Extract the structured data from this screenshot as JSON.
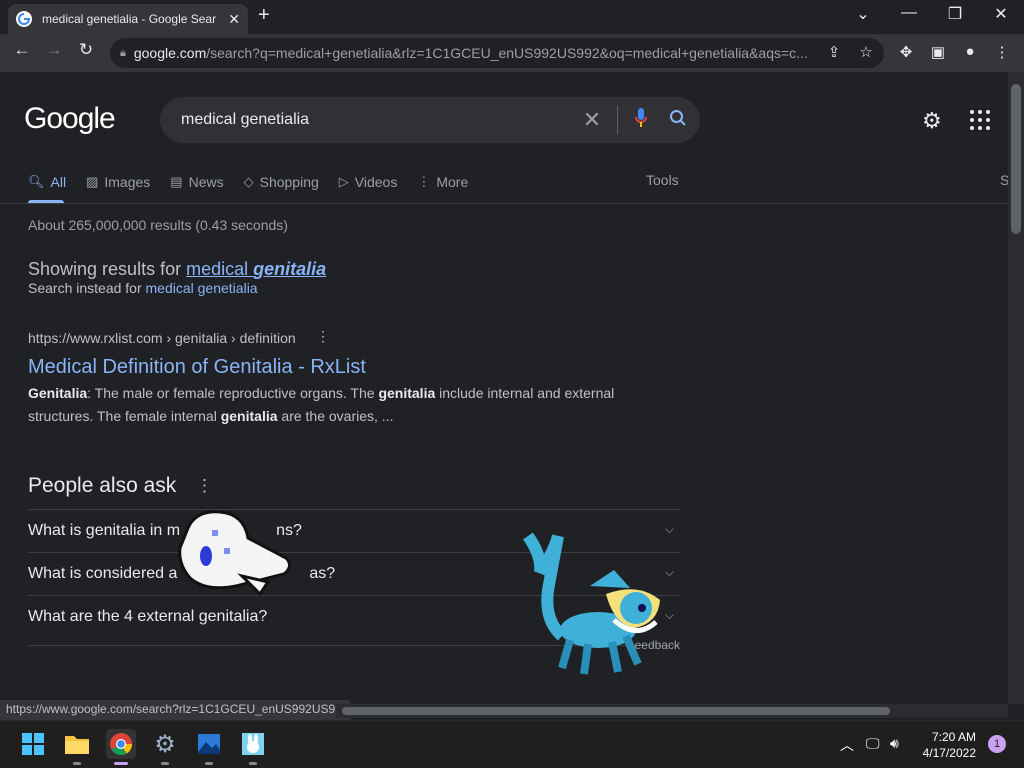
{
  "browser": {
    "tab_title": "medical genetialia - Google Sear",
    "url_host": "google.com",
    "url_rest": "/search?q=medical+genetialia&rlz=1C1GCEU_enUS992US992&oq=medical+genetialia&aqs=c...",
    "status_url": "https://www.google.com/search?rlz=1C1GCEU_enUS992US9..."
  },
  "google": {
    "logo": "Google",
    "query": "medical genetialia",
    "tabs": [
      {
        "label": "All",
        "icon": "search-icon"
      },
      {
        "label": "Images",
        "icon": "image-icon"
      },
      {
        "label": "News",
        "icon": "news-icon"
      },
      {
        "label": "Shopping",
        "icon": "tag-icon"
      },
      {
        "label": "Videos",
        "icon": "video-icon"
      },
      {
        "label": "More",
        "icon": "more-icon"
      }
    ],
    "tools": "Tools",
    "s_fragment": "S",
    "stats": "About 265,000,000 results (0.43 seconds)",
    "showing_prefix": "Showing results for ",
    "showing_word1": "medical ",
    "showing_word2": "genitalia",
    "instead_prefix": "Search instead for ",
    "instead_link": "medical genetialia",
    "result": {
      "cite": "https://www.rxlist.com › genitalia › definition",
      "title": "Medical Definition of Genitalia - RxList",
      "s1b": "Genitalia",
      "s1": ": The male or female reproductive organs. The ",
      "s2b": "genitalia",
      "s2": " include internal and external structures. The female internal ",
      "s3b": "genitalia",
      "s3": " are the ovaries, ..."
    },
    "paa_title": "People also ask",
    "questions": [
      "What is genitalia in m",
      "What is considered a",
      "What are the 4 external genitalia?"
    ],
    "q1_tail": "ns?",
    "q2_tail": "as?",
    "feedback": "eedback"
  },
  "taskbar": {
    "time": "7:20 AM",
    "date": "4/17/2022",
    "notifications": "1"
  }
}
